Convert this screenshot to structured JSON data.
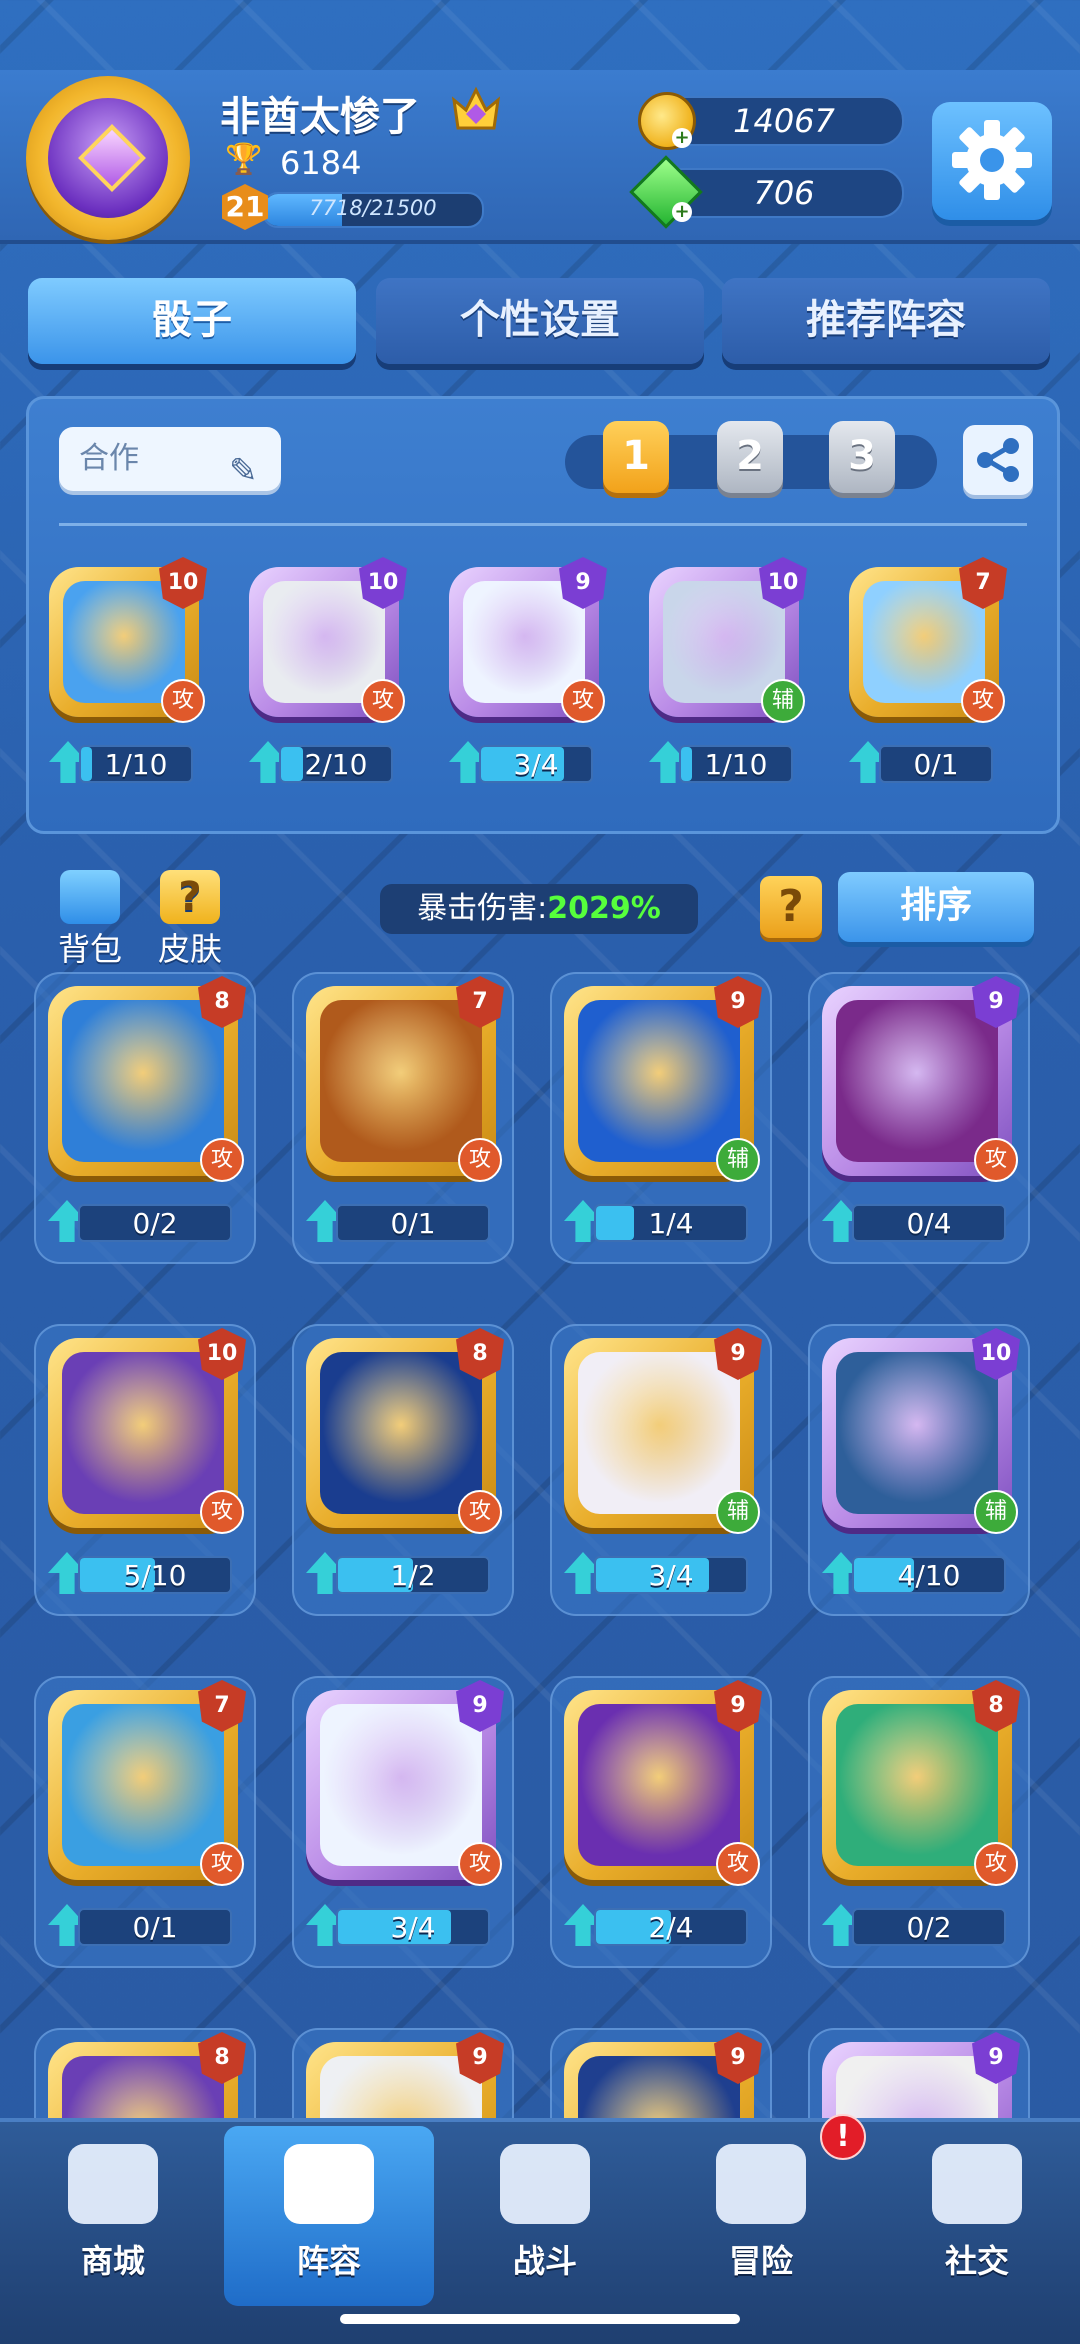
{
  "player": {
    "name": "非酋太惨了",
    "trophies": "6184",
    "level": "21",
    "xp_text": "7718/21500",
    "xp_fraction": 0.359
  },
  "resources": {
    "coins": "14067",
    "gems": "706"
  },
  "tabs": [
    "骰子",
    "个性设置",
    "推荐阵容"
  ],
  "deck": {
    "name": "合作",
    "slots": [
      "1",
      "2",
      "3"
    ],
    "active_slot": 0,
    "cards": [
      {
        "level": "10",
        "role": "攻",
        "progress_text": "1/10",
        "fraction": 0.1,
        "frame": "gold",
        "icon": "robot-dice-icon",
        "color": "#4aa2ef"
      },
      {
        "level": "10",
        "role": "攻",
        "progress_text": "2/10",
        "fraction": 0.2,
        "frame": "purple",
        "icon": "volcano-dice-icon",
        "color": "#e9ecf0"
      },
      {
        "level": "9",
        "role": "攻",
        "progress_text": "3/4",
        "fraction": 0.75,
        "frame": "purple",
        "icon": "holy-cross-dice-icon",
        "color": "#eef4ff"
      },
      {
        "level": "10",
        "role": "辅",
        "progress_text": "1/10",
        "fraction": 0.1,
        "frame": "purple",
        "icon": "moon-dice-icon",
        "color": "#c9d6ea"
      },
      {
        "level": "7",
        "role": "攻",
        "progress_text": "0/1",
        "fraction": 0.0,
        "frame": "gold",
        "icon": "shark-dice-icon",
        "color": "#8fd0ff"
      }
    ]
  },
  "collection": {
    "bag_label": "背包",
    "skin_label": "皮肤",
    "crit_label": "暴击伤害:",
    "crit_value": "2029%",
    "help_label": "?",
    "sort_label": "排序",
    "cards": [
      {
        "level": "8",
        "role": "攻",
        "progress_text": "0/2",
        "fraction": 0.0,
        "frame": "gold",
        "icon": "water-dice-icon",
        "color": "#2f7fd8"
      },
      {
        "level": "7",
        "role": "攻",
        "progress_text": "0/1",
        "fraction": 0.0,
        "frame": "gold",
        "icon": "tiger-dice-icon",
        "color": "#b05a1c"
      },
      {
        "level": "9",
        "role": "辅",
        "progress_text": "1/4",
        "fraction": 0.25,
        "frame": "gold",
        "icon": "shield-s-dice-icon",
        "color": "#1f5fcf"
      },
      {
        "level": "9",
        "role": "攻",
        "progress_text": "0/4",
        "fraction": 0.0,
        "frame": "purple",
        "icon": "shadow-dice-icon",
        "color": "#7a2a8a"
      },
      {
        "level": "10",
        "role": "攻",
        "progress_text": "5/10",
        "fraction": 0.5,
        "frame": "gold",
        "icon": "archer-dice-icon",
        "color": "#6a3fb5"
      },
      {
        "level": "8",
        "role": "攻",
        "progress_text": "1/2",
        "fraction": 0.5,
        "frame": "gold",
        "icon": "scorpion-dice-icon",
        "color": "#1a3d8f"
      },
      {
        "level": "9",
        "role": "辅",
        "progress_text": "3/4",
        "fraction": 0.75,
        "frame": "gold",
        "icon": "witch-hat-dice-icon",
        "color": "#f1eef6"
      },
      {
        "level": "10",
        "role": "辅",
        "progress_text": "4/10",
        "fraction": 0.4,
        "frame": "purple",
        "icon": "dandelion-dice-icon",
        "color": "#2e5f9a"
      },
      {
        "level": "7",
        "role": "攻",
        "progress_text": "0/1",
        "fraction": 0.0,
        "frame": "gold",
        "icon": "dragon-dice-icon",
        "color": "#3a9fe2"
      },
      {
        "level": "9",
        "role": "攻",
        "progress_text": "3/4",
        "fraction": 0.75,
        "frame": "purple",
        "icon": "holy-cross-dice-icon",
        "color": "#eef4ff"
      },
      {
        "level": "9",
        "role": "攻",
        "progress_text": "2/4",
        "fraction": 0.5,
        "frame": "gold",
        "icon": "light-rays-dice-icon",
        "color": "#6a2fb0"
      },
      {
        "level": "8",
        "role": "攻",
        "progress_text": "0/2",
        "fraction": 0.0,
        "frame": "gold",
        "icon": "ghost-dice-icon",
        "color": "#2fae7a"
      },
      {
        "level": "8",
        "role": "",
        "progress_text": "",
        "fraction": 0.0,
        "frame": "gold",
        "icon": "partial-dice-icon",
        "color": "#6a3fb5"
      },
      {
        "level": "9",
        "role": "",
        "progress_text": "",
        "fraction": 0.0,
        "frame": "gold",
        "icon": "panda-dice-icon",
        "color": "#eef0f3"
      },
      {
        "level": "9",
        "role": "",
        "progress_text": "",
        "fraction": 0.0,
        "frame": "gold",
        "icon": "dark-wave-dice-icon",
        "color": "#1f3f8f"
      },
      {
        "level": "9",
        "role": "",
        "progress_text": "",
        "fraction": 0.0,
        "frame": "purple",
        "icon": "yin-yang-dice-icon",
        "color": "#f0f0f0"
      }
    ]
  },
  "nav": [
    {
      "label": "商城",
      "icon": "shop-icon"
    },
    {
      "label": "阵容",
      "icon": "dice-icon"
    },
    {
      "label": "战斗",
      "icon": "crossed-swords-icon"
    },
    {
      "label": "冒险",
      "icon": "planet-icon"
    },
    {
      "label": "社交",
      "icon": "chat-bubbles-icon"
    }
  ],
  "nav_active": 1,
  "nav_badge": "!",
  "colors": {
    "accent": "#3b94ea",
    "gold": "#f0b21c",
    "attack": "#e0592b",
    "support": "#3dab3a",
    "crit": "#56ff3c"
  }
}
